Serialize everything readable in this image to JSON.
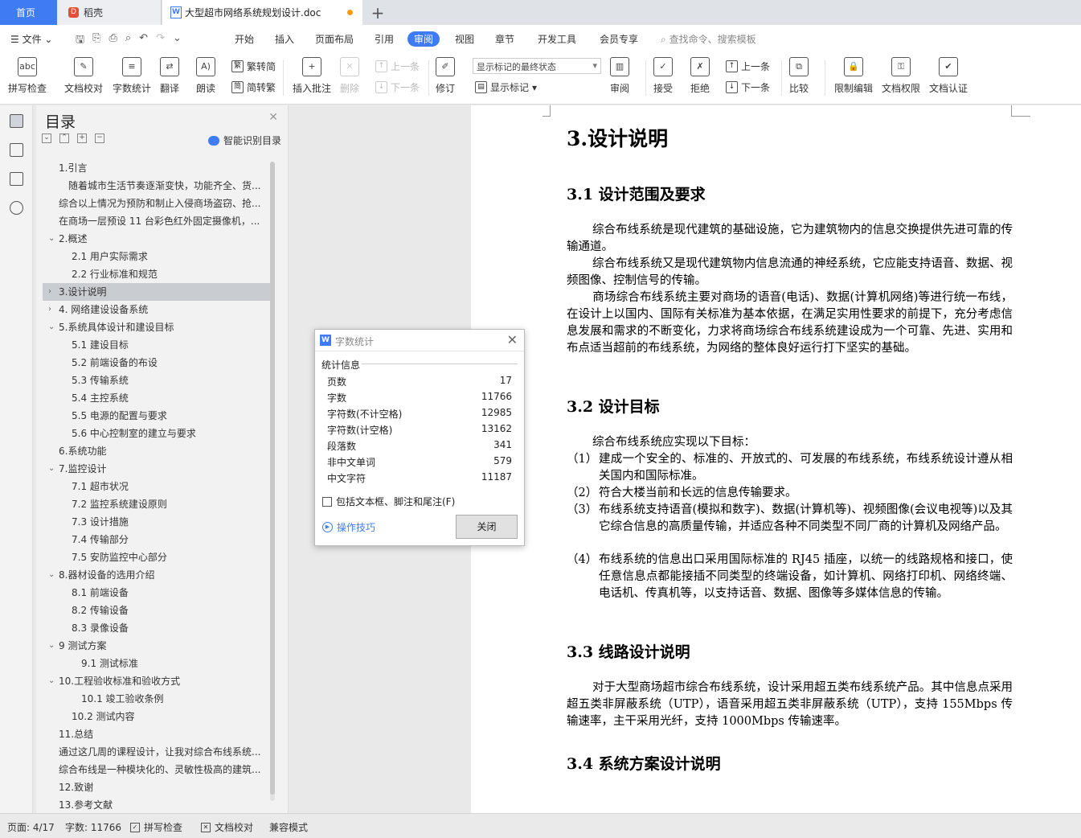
{
  "tabs": {
    "home": "首页",
    "docer": "稻壳",
    "document": "大型超市网络系统规划设计.doc",
    "add": "+"
  },
  "menu": {
    "file": "文件",
    "items": [
      "开始",
      "插入",
      "页面布局",
      "引用",
      "审阅",
      "视图",
      "章节",
      "开发工具",
      "会员专享"
    ],
    "active": "审阅",
    "search": "查找命令、搜索模板"
  },
  "ribbon": {
    "spellcheck": "拼写检查",
    "doc_check": "文档校对",
    "word_count": "字数统计",
    "translate": "翻译",
    "read_aloud": "朗读",
    "to_traditional": "繁转简",
    "to_simplified": "简转繁",
    "insert_comment": "插入批注",
    "delete": "删除",
    "prev_comment": "上一条",
    "next_comment": "下一条",
    "track_changes": "修订",
    "markup_select": "显示标记的最终状态",
    "show_markup": "显示标记",
    "review": "审阅",
    "accept": "接受",
    "reject": "拒绝",
    "prev": "上一条",
    "next": "下一条",
    "compare": "比较",
    "restrict_edit": "限制编辑",
    "doc_permission": "文档权限",
    "doc_auth": "文档认证"
  },
  "toc": {
    "title": "目录",
    "smart_label": "智能识别目录",
    "items": [
      {
        "text": "1.引言",
        "indent": 0,
        "caret": ""
      },
      {
        "text": "随着城市生活节奏逐渐变快，功能齐全、货...",
        "indent": 1,
        "caret": ""
      },
      {
        "text": "综合以上情况为预防和制止入侵商场盗窃、抢...",
        "indent": 0,
        "caret": ""
      },
      {
        "text": "在商场一层预设 11 台彩色红外固定摄像机，...",
        "indent": 0,
        "caret": ""
      },
      {
        "text": "2.概述",
        "indent": 0,
        "caret": "⌄"
      },
      {
        "text": "2.1 用户实际需求",
        "indent": 2,
        "caret": ""
      },
      {
        "text": "2.2 行业标准和规范",
        "indent": 2,
        "caret": ""
      },
      {
        "text": "3.设计说明",
        "indent": 0,
        "caret": "›"
      },
      {
        "text": "4. 网络建设设备系统",
        "indent": 0,
        "caret": "›"
      },
      {
        "text": "5.系统具体设计和建设目标",
        "indent": 0,
        "caret": "⌄"
      },
      {
        "text": "5.1 建设目标",
        "indent": 2,
        "caret": ""
      },
      {
        "text": "5.2 前端设备的布设",
        "indent": 2,
        "caret": ""
      },
      {
        "text": "5.3 传输系统",
        "indent": 2,
        "caret": ""
      },
      {
        "text": "5.4 主控系统",
        "indent": 2,
        "caret": ""
      },
      {
        "text": "5.5 电源的配置与要求",
        "indent": 2,
        "caret": ""
      },
      {
        "text": "5.6 中心控制室的建立与要求",
        "indent": 2,
        "caret": ""
      },
      {
        "text": "6.系统功能",
        "indent": 0,
        "caret": ""
      },
      {
        "text": "7.监控设计",
        "indent": 0,
        "caret": "⌄"
      },
      {
        "text": "7.1 超市状况",
        "indent": 2,
        "caret": ""
      },
      {
        "text": "7.2 监控系统建设原则",
        "indent": 2,
        "caret": ""
      },
      {
        "text": "7.3 设计措施",
        "indent": 2,
        "caret": ""
      },
      {
        "text": "7.4 传输部分",
        "indent": 2,
        "caret": ""
      },
      {
        "text": "7.5 安防监控中心部分",
        "indent": 2,
        "caret": ""
      },
      {
        "text": "8.器材设备的选用介绍",
        "indent": 0,
        "caret": "⌄"
      },
      {
        "text": "8.1 前端设备",
        "indent": 2,
        "caret": ""
      },
      {
        "text": "8.2 传输设备",
        "indent": 2,
        "caret": ""
      },
      {
        "text": "8.3 录像设备",
        "indent": 2,
        "caret": ""
      },
      {
        "text": "9 测试方案",
        "indent": 0,
        "caret": "⌄"
      },
      {
        "text": "9.1  测试标准",
        "indent": 3,
        "caret": ""
      },
      {
        "text": "10.工程验收标准和验收方式",
        "indent": 0,
        "caret": "⌄"
      },
      {
        "text": "10.1  竣工验收条例",
        "indent": 3,
        "caret": ""
      },
      {
        "text": "10.2 测试内容",
        "indent": 2,
        "caret": ""
      },
      {
        "text": "11.总结",
        "indent": 0,
        "caret": ""
      },
      {
        "text": "通过这几周的课程设计，让我对综合布线系统...",
        "indent": 0,
        "caret": ""
      },
      {
        "text": "综合布线是一种模块化的、灵敏性极高的建筑...",
        "indent": 0,
        "caret": ""
      },
      {
        "text": "12.致谢",
        "indent": 0,
        "caret": ""
      },
      {
        "text": "13.参考文献",
        "indent": 0,
        "caret": ""
      }
    ],
    "active_index": 7
  },
  "document": {
    "h1": "3.设计说明",
    "s31_title": "3.1 设计范围及要求",
    "s31_p1": "综合布线系统是现代建筑的基础设施，它为建筑物内的信息交换提供先进可靠的传输通道。",
    "s31_p2": "综合布线系统又是现代建筑物内信息流通的神经系统，它应能支持语音、数据、视频图像、控制信号的传输。",
    "s31_p3": "商场综合布线系统主要对商场的语音(电话)、数据(计算机网络)等进行统一布线，在设计上以国内、国际有关标准为基本依据，在满足实用性要求的前提下，充分考虑信息发展和需求的不断变化，力求将商场综合布线系统建设成为一个可靠、先进、实用和布点适当超前的布线系统，为网络的整体良好运行打下坚实的基础。",
    "s32_title": "3.2 设计目标",
    "s32_intro": "综合布线系统应实现以下目标：",
    "s32_items": [
      {
        "num": "（1）",
        "text": "建成一个安全的、标准的、开放式的、可发展的布线系统，布线系统设计遵从相关国内和国际标准。"
      },
      {
        "num": "（2）",
        "text": "符合大楼当前和长远的信息传输要求。"
      },
      {
        "num": "（3）",
        "text": "布线系统支持语音(模拟和数字)、数据(计算机等)、视频图像(会议电视等)以及其它综合信息的高质量传输，并适应各种不同类型不同厂商的计算机及网络产品。"
      },
      {
        "num": "（4）",
        "text": "布线系统的信息出口采用国际标准的 RJ45 插座，以统一的线路规格和接口，使任意信息点都能接插不同类型的终端设备，如计算机、网络打印机、网络终端、电话机、传真机等，以支持话音、数据、图像等多媒体信息的传输。"
      }
    ],
    "s33_title": "3.3 线路设计说明",
    "s33_p1": "对于大型商场超市综合布线系统，设计采用超五类布线系统产品。其中信息点采用超五类非屏蔽系统（UTP），语音采用超五类非屏蔽系统（UTP），支持 155Mbps 传输速率，主干采用光纤，支持 1000Mbps 传输速率。",
    "s34_title": "3.4 系统方案设计说明"
  },
  "dialog": {
    "title": "字数统计",
    "section": "统计信息",
    "stats": [
      {
        "label": "页数",
        "value": "17"
      },
      {
        "label": "字数",
        "value": "11766"
      },
      {
        "label": "字符数(不计空格)",
        "value": "12985"
      },
      {
        "label": "字符数(计空格)",
        "value": "13162"
      },
      {
        "label": "段落数",
        "value": "341"
      },
      {
        "label": "非中文单词",
        "value": "579"
      },
      {
        "label": "中文字符",
        "value": "11187"
      }
    ],
    "include_label": "包括文本框、脚注和尾注(F)",
    "tips_label": "操作技巧",
    "close_label": "关闭"
  },
  "status": {
    "page": "页面: 4/17",
    "words": "字数: 11766",
    "spell": "拼写检查",
    "doccheck": "文档校对",
    "compat": "兼容模式"
  },
  "colors": {
    "accent": "#3f7cf3",
    "toc_active": "#c9ccd1"
  }
}
